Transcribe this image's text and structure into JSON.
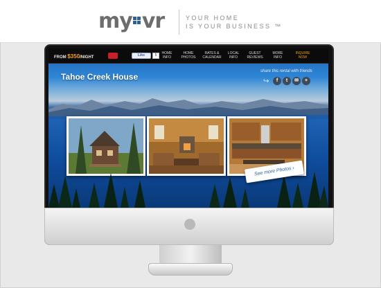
{
  "brand": {
    "logo_left": "my",
    "logo_right": "vr",
    "tagline_line1": "YOUR HOME",
    "tagline_line2": "IS YOUR BUSINESS ™",
    "logo_color": "#6d6d6d",
    "accent_color": "#2f5f8f"
  },
  "navbar": {
    "price_prefix": "FROM",
    "price_amount": "$350",
    "price_suffix": "/NIGHT",
    "like_label": "Like",
    "like_count": "5",
    "items": [
      {
        "label": "HOME INFO"
      },
      {
        "label": "HOME PHOTOS"
      },
      {
        "label": "RATES & CALENDAR"
      },
      {
        "label": "LOCAL INFO"
      },
      {
        "label": "GUEST REVIEWS"
      },
      {
        "label": "MORE INFO"
      },
      {
        "label": "INQUIRE NOW"
      }
    ]
  },
  "hero": {
    "title": "Tahoe Creek House",
    "share_label": "share this rental with friends",
    "social_icons": [
      "facebook-icon",
      "twitter-icon",
      "email-icon",
      "share-icon"
    ],
    "more_photos_label": "See more Photos ›"
  }
}
